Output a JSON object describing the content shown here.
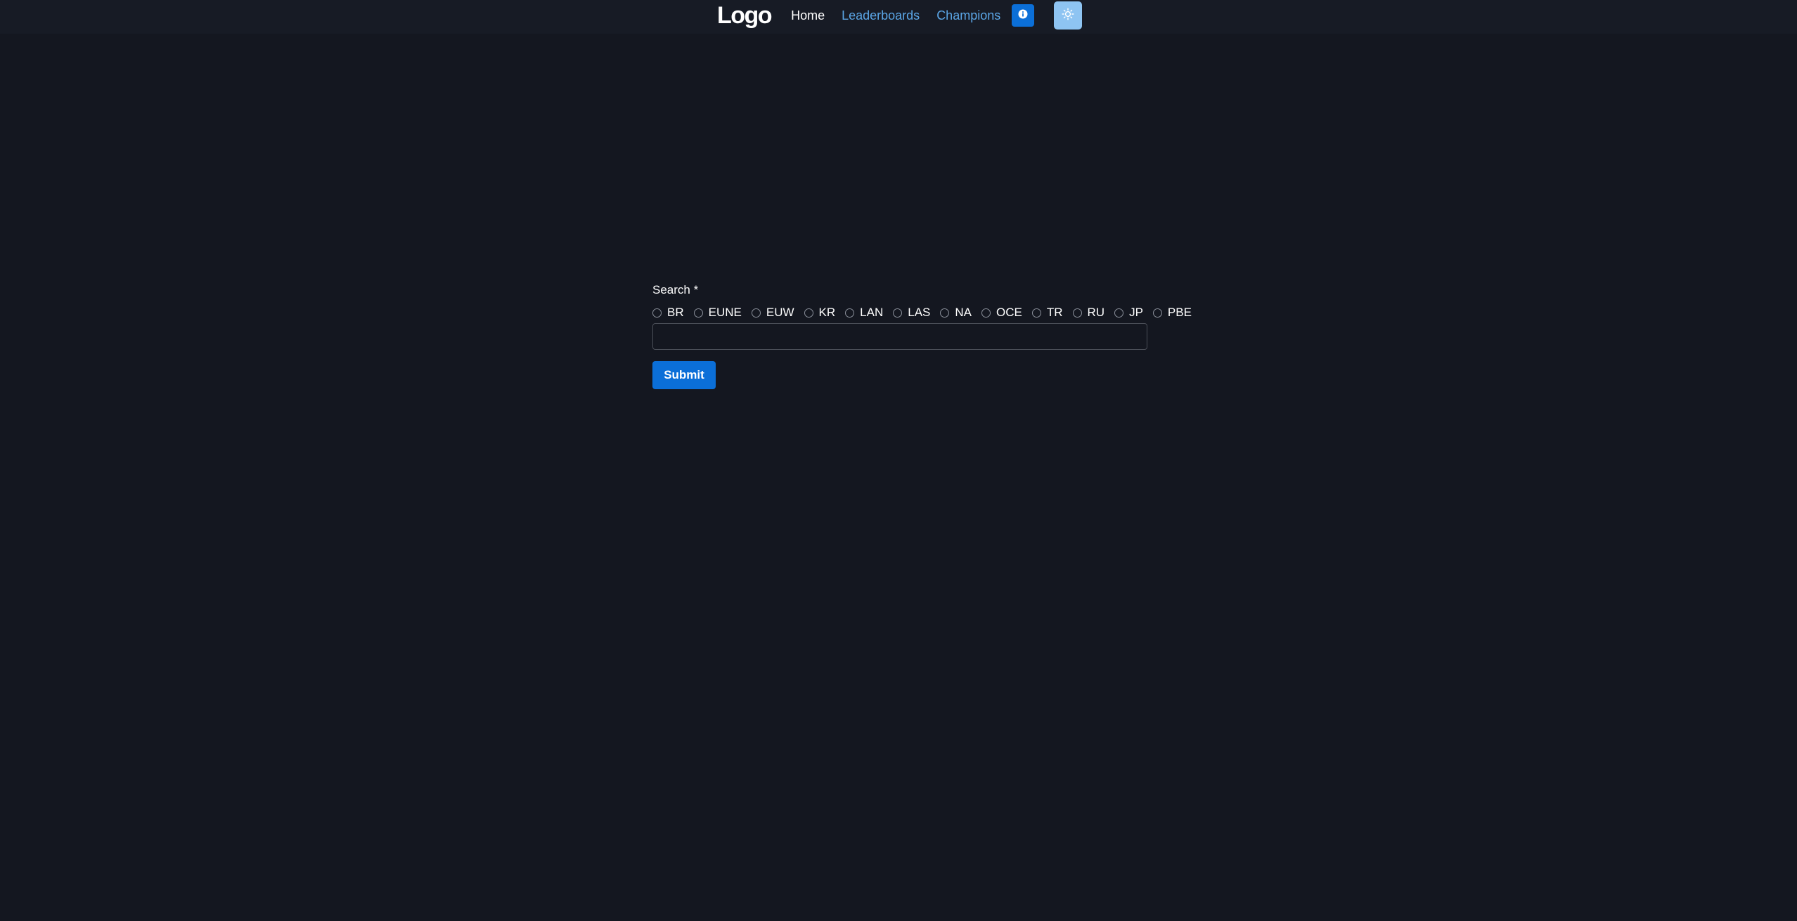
{
  "navbar": {
    "logo": "Logo",
    "links": [
      {
        "label": "Home",
        "active": true
      },
      {
        "label": "Leaderboards",
        "active": false
      },
      {
        "label": "Champions",
        "active": false
      }
    ],
    "info_icon": "info-circle-icon",
    "theme_icon": "sun-icon"
  },
  "form": {
    "search_label": "Search *",
    "regions": [
      "BR",
      "EUNE",
      "EUW",
      "KR",
      "LAN",
      "LAS",
      "NA",
      "OCE",
      "TR",
      "RU",
      "JP",
      "PBE"
    ],
    "input_value": "",
    "submit_label": "Submit"
  },
  "colors": {
    "background": "#141720",
    "navbar": "#171b25",
    "accent": "#0b6fd8",
    "link": "#5ba6e6",
    "theme_button": "#8ec4f2"
  }
}
